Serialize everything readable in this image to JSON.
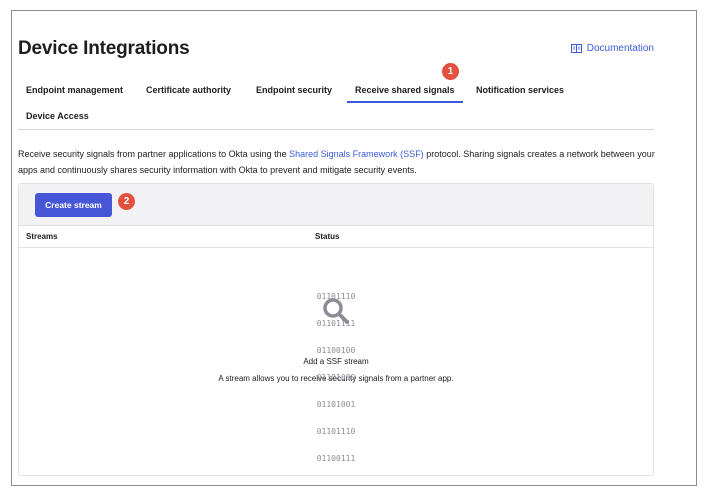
{
  "page": {
    "title": "Device Integrations",
    "documentation_label": "Documentation"
  },
  "tabs": [
    {
      "label": "Endpoint management",
      "active": false
    },
    {
      "label": "Certificate authority",
      "active": false
    },
    {
      "label": "Endpoint security",
      "active": false
    },
    {
      "label": "Receive shared signals",
      "active": true
    },
    {
      "label": "Notification services",
      "active": false
    },
    {
      "label": "Device Access",
      "active": false
    }
  ],
  "description": {
    "before": "Receive security signals from partner applications to Okta using the ",
    "link": "Shared Signals Framework (SSF)",
    "after": " protocol. Sharing signals creates a network between your apps and continuously shares security information with Okta to prevent and mitigate security events."
  },
  "toolbar": {
    "create_stream_label": "Create stream"
  },
  "table": {
    "columns": [
      "Streams",
      "Status"
    ]
  },
  "empty_state": {
    "binary_lines": [
      "01101110",
      "01101111",
      "01100100",
      "01101000",
      "01101001",
      "01101110",
      "01100111"
    ],
    "title": "Add a SSF stream",
    "subtitle": "A stream allows you to receive security signals from a partner app."
  },
  "callouts": {
    "one": "1",
    "two": "2"
  },
  "colors": {
    "accent": "#3b5bdb",
    "button": "#4756d6",
    "callout": "#e3503e"
  },
  "icons": {
    "documentation": "book-icon",
    "empty_state": "magnifier-icon"
  }
}
